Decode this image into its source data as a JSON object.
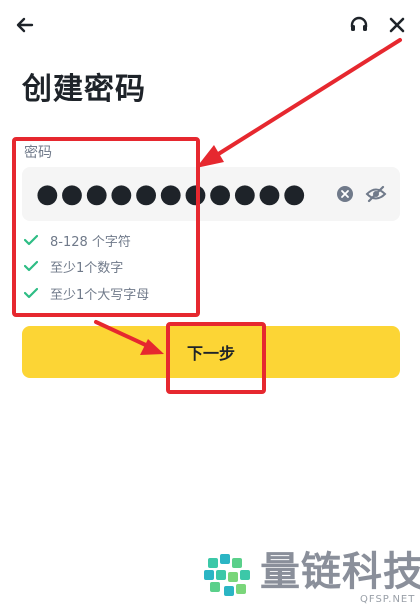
{
  "header": {
    "back_icon": "arrow-left-icon",
    "support_icon": "headset-icon",
    "close_icon": "close-icon"
  },
  "page": {
    "title": "创建密码"
  },
  "password": {
    "label": "密码",
    "masked_value": "●●●●●●●●●●●",
    "clear_icon": "clear-circle-icon",
    "visibility_icon": "eye-off-icon"
  },
  "rules": [
    {
      "text": "8-128 个字符",
      "icon": "check-icon",
      "satisfied": true
    },
    {
      "text": "至少1个数字",
      "icon": "check-icon",
      "satisfied": true
    },
    {
      "text": "至少1个大写字母",
      "icon": "check-icon",
      "satisfied": true
    }
  ],
  "actions": {
    "next_label": "下一步"
  },
  "watermark": {
    "name": "量链科技",
    "url": "QFSP.NET"
  },
  "colors": {
    "accent": "#fcd535",
    "check": "#2ebd85",
    "annotation": "#e6282f",
    "input_bg": "#f5f5f5"
  }
}
